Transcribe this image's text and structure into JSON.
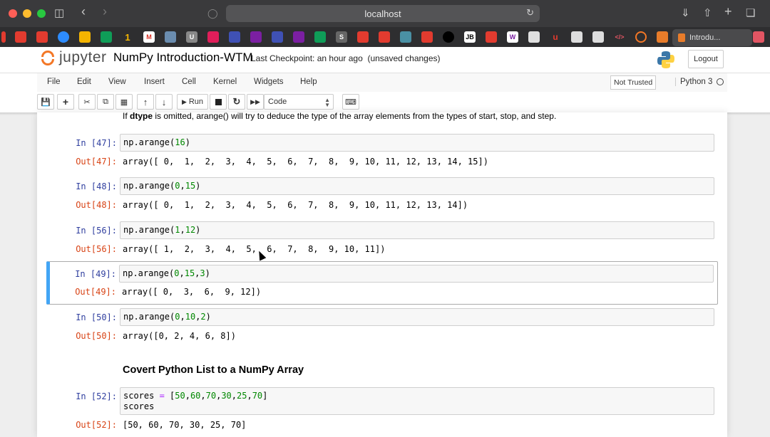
{
  "browser": {
    "url": "localhost",
    "active_tab_title": "Introdu..."
  },
  "jupyter": {
    "logo_text": "jupyter",
    "notebook_title": "NumPy Introduction-WTM",
    "checkpoint": "Last Checkpoint: an hour ago",
    "status": "(unsaved changes)",
    "logout_label": "Logout",
    "menu": [
      "File",
      "Edit",
      "View",
      "Insert",
      "Cell",
      "Kernel",
      "Widgets",
      "Help"
    ],
    "trust_label": "Not Trusted",
    "kernel_name": "Python 3",
    "toolbar": {
      "run_label": "Run",
      "cell_type": "Code"
    }
  },
  "notebook": {
    "markdown_intro": {
      "prefix": "If ",
      "bold": "dtype",
      "suffix": " is omitted, arange() will try to deduce the type of the array elements from the types of start, stop, and step."
    },
    "cells": [
      {
        "in_prompt": "In [47]:",
        "code": "np.arange(16)",
        "out_prompt": "Out[47]:",
        "output": "array([ 0,  1,  2,  3,  4,  5,  6,  7,  8,  9, 10, 11, 12, 13, 14, 15])"
      },
      {
        "in_prompt": "In [48]:",
        "code": "np.arange(0,15)",
        "out_prompt": "Out[48]:",
        "output": "array([ 0,  1,  2,  3,  4,  5,  6,  7,  8,  9, 10, 11, 12, 13, 14])"
      },
      {
        "in_prompt": "In [56]:",
        "code": "np.arange(1,12)",
        "out_prompt": "Out[56]:",
        "output": "array([ 1,  2,  3,  4,  5,  6,  7,  8,  9, 10, 11])"
      },
      {
        "in_prompt": "In [49]:",
        "code": "np.arange(0,15,3)",
        "out_prompt": "Out[49]:",
        "output": "array([ 0,  3,  6,  9, 12])"
      },
      {
        "in_prompt": "In [50]:",
        "code": "np.arange(0,10,2)",
        "out_prompt": "Out[50]:",
        "output": "array([0, 2, 4, 6, 8])"
      },
      {
        "in_prompt": "In [52]:",
        "code": "scores = [50,60,70,30,25,70]\nscores",
        "out_prompt": "Out[52]:",
        "output": "[50, 60, 70, 30, 25, 70]"
      }
    ],
    "heading": "Covert Python List to a NumPy Array"
  }
}
